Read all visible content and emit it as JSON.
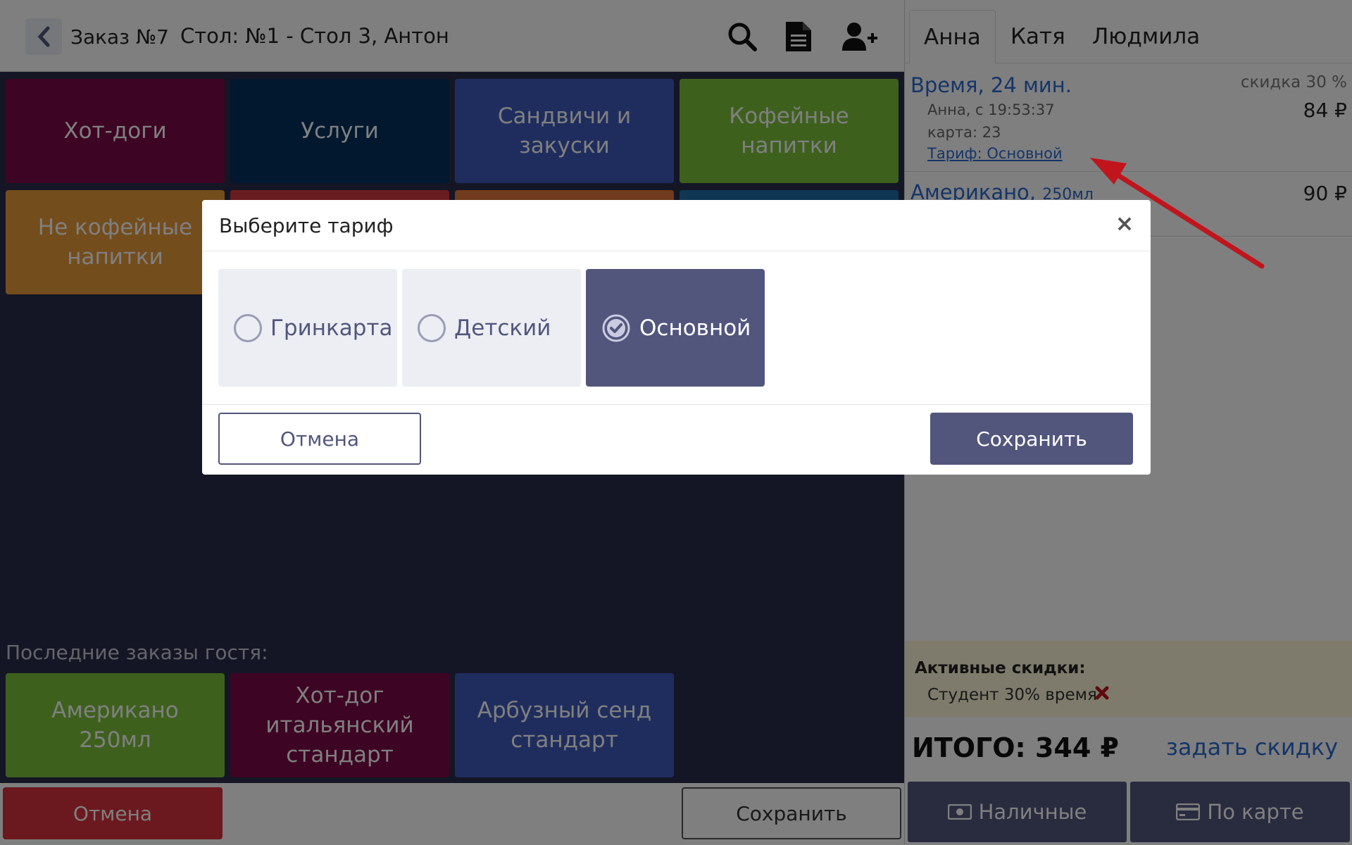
{
  "header": {
    "order_title": "Заказ №7",
    "table_info": "Стол: №1 - Стол 3, Антон",
    "icons": [
      "chevron-left-icon",
      "search-icon",
      "document-icon",
      "add-user-icon"
    ]
  },
  "categories": [
    {
      "label": "Хот-доги",
      "color": "#7a0a47"
    },
    {
      "label": "Услуги",
      "color": "#02305e"
    },
    {
      "label": "Сандвичи и закуски",
      "color": "#3f5bbd"
    },
    {
      "label": "Кофейные напитки",
      "color": "#7cc13b"
    },
    {
      "label": "Не кофейные напитки",
      "color": "#e89a3a"
    },
    {
      "label": "",
      "color": "#d2393f"
    },
    {
      "label": "",
      "color": "#e0763f"
    },
    {
      "label": "",
      "color": "#1e6fa6"
    }
  ],
  "recent": {
    "label": "Последние заказы гостя:",
    "items": [
      {
        "label": "Американо 250мл",
        "color": "#7cc13b"
      },
      {
        "label": "Хот-дог итальянский стандарт",
        "color": "#7a0a47"
      },
      {
        "label": "Арбузный сенд стандарт",
        "color": "#3f5bbd"
      }
    ]
  },
  "bottom_bar": {
    "cancel": "Отмена",
    "save": "Сохранить"
  },
  "guests": {
    "tabs": [
      "Анна",
      "Катя",
      "Людмила"
    ],
    "active_tab": 0
  },
  "order_items": [
    {
      "name": "Время, 24 мин.",
      "discount": "скидка 30 %",
      "meta1": "Анна, с 19:53:37",
      "meta2": "карта: 23",
      "tariff": "Тариф: Основной",
      "price": "84 ₽"
    },
    {
      "name": "Американо,",
      "size": "250мл",
      "price": "90 ₽"
    }
  ],
  "active_discounts": {
    "title": "Активные скидки:",
    "items": [
      "Студент 30% время"
    ]
  },
  "totals": {
    "total": "ИТОГО: 344 ₽",
    "set_discount": "задать скидку"
  },
  "payment": {
    "cash": "Наличные",
    "card": "По карте"
  },
  "modal": {
    "title": "Выберите тариф",
    "close": "×",
    "options": [
      {
        "label": "Гринкарта",
        "selected": false
      },
      {
        "label": "Детский",
        "selected": false
      },
      {
        "label": "Основной",
        "selected": true
      }
    ],
    "cancel": "Отмена",
    "save": "Сохранить"
  },
  "colors": {
    "accent": "#52567d",
    "link": "#2a6bd1",
    "danger": "#d6323e",
    "annotation_arrow": "#c0151d"
  }
}
